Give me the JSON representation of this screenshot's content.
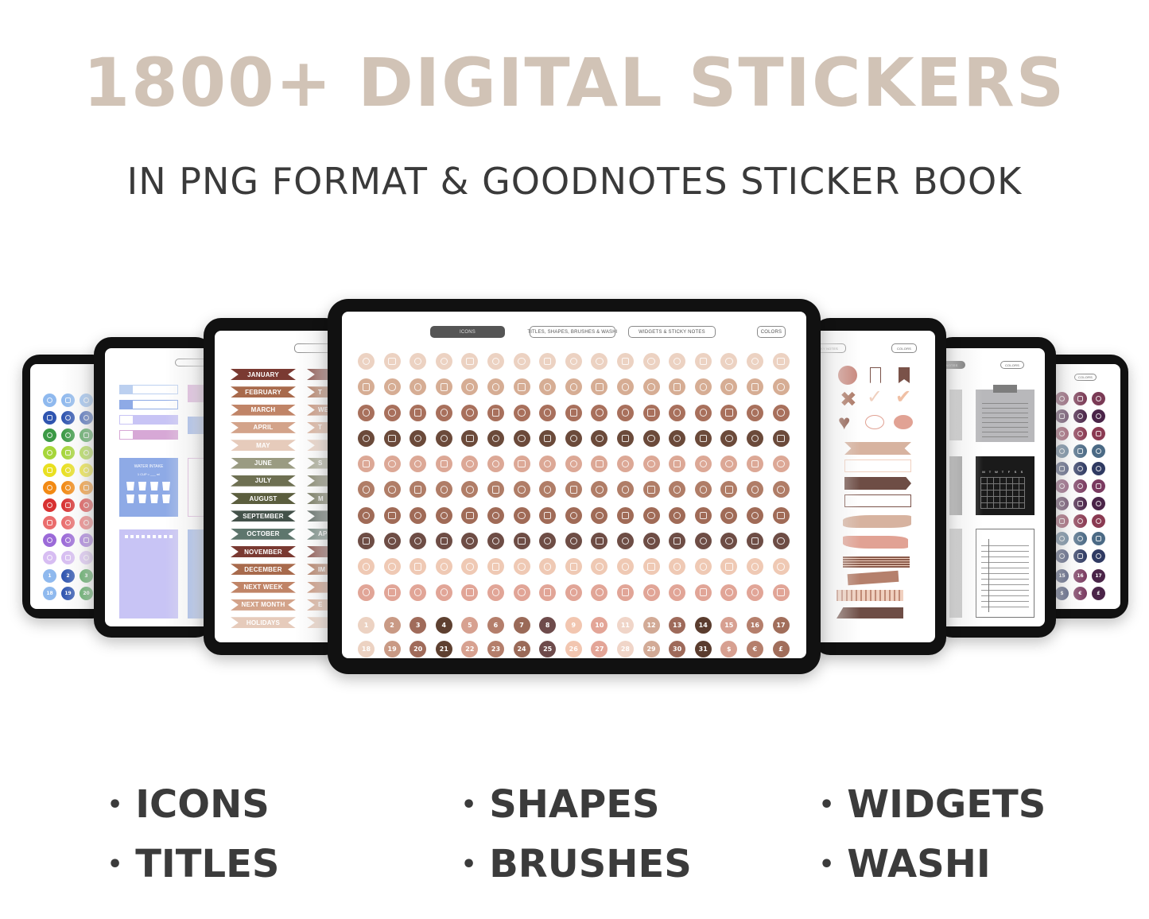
{
  "headline": "1800+ DIGITAL STICKERS",
  "subheadline": "IN PNG FORMAT & GOODNOTES STICKER BOOK",
  "center_tablet": {
    "tabs": [
      {
        "label": "ICONS",
        "active": true
      },
      {
        "label": "TITLES, SHAPES, BRUSHES & WASHI",
        "active": false
      },
      {
        "label": "WIDGETS & STICKY NOTES",
        "active": false
      },
      {
        "label": "COLORS",
        "active": false
      }
    ],
    "icon_row_colors": [
      "#ecd2c2",
      "#d6ad94",
      "#a8705c",
      "#6b4a3a",
      "#dca896",
      "#b07d67",
      "#a06b57",
      "#6e4d45",
      "#efc9b4",
      "#e1a597"
    ],
    "number_rows": [
      [
        "1",
        "2",
        "3",
        "4",
        "5",
        "6",
        "7",
        "8",
        "9",
        "10",
        "11",
        "12",
        "13",
        "14",
        "15",
        "16",
        "17"
      ],
      [
        "18",
        "19",
        "20",
        "21",
        "22",
        "23",
        "24",
        "25",
        "26",
        "27",
        "28",
        "29",
        "30",
        "31",
        "$",
        "€",
        "£"
      ]
    ],
    "number_colors": [
      "#ecd2c2",
      "#c99a85",
      "#a06b5a",
      "#5e4030",
      "#d7a190",
      "#b47e6b",
      "#9a6a58",
      "#6e4b4b",
      "#f2c6b0",
      "#e3a597",
      "#f0d5c8",
      "#d2aa96",
      "#9e6a5a",
      "#5a3c2e",
      "#d7a091",
      "#b57f6c",
      "#a16e5b"
    ]
  },
  "left_titles_tablet": {
    "tab_partial": "",
    "months": [
      {
        "label": "JANUARY",
        "color": "#7a3a32"
      },
      {
        "label": "FEBRUARY",
        "color": "#a86a4c"
      },
      {
        "label": "MARCH",
        "color": "#c08467"
      },
      {
        "label": "APRIL",
        "color": "#d3a38a"
      },
      {
        "label": "MAY",
        "color": "#e6cbbb"
      },
      {
        "label": "JUNE",
        "color": "#9a9b82"
      },
      {
        "label": "JULY",
        "color": "#6e7052"
      },
      {
        "label": "AUGUST",
        "color": "#5b5e3e"
      },
      {
        "label": "SEPTEMBER",
        "color": "#44524a"
      },
      {
        "label": "OCTOBER",
        "color": "#5e766d"
      },
      {
        "label": "NOVEMBER",
        "color": "#7a3a32"
      },
      {
        "label": "DECEMBER",
        "color": "#a86a4c"
      },
      {
        "label": "NEXT WEEK",
        "color": "#c08467"
      },
      {
        "label": "NEXT MONTH",
        "color": "#d3a38a"
      },
      {
        "label": "HOLIDAYS",
        "color": "#e6cbbb"
      }
    ],
    "second_column_fragments": [
      "",
      "T",
      "WE",
      "T",
      "",
      "S",
      "",
      "M",
      "",
      "AP",
      "",
      "IM",
      "",
      "E",
      ""
    ]
  },
  "left_widgets_tablet": {
    "widget_title": "WATER INTAKE",
    "widget_subtitle": "1 CUP = ___ ml",
    "bar_colors": [
      "#bcd0f0",
      "#8eaae6",
      "#c8c4f5",
      "#d7a8d6"
    ]
  },
  "far_left_tablet": {
    "row_colors": [
      "#8fb9ee",
      "#2f55b0",
      "#3c9a46",
      "#a6d63a",
      "#e9e021",
      "#f28a14",
      "#d83131",
      "#ea6d6d",
      "#9b6ad8",
      "#d7bdf2"
    ],
    "numbers": [
      [
        "1",
        "2",
        "3"
      ],
      [
        "18",
        "19",
        "20"
      ]
    ],
    "number_colors": [
      "#8fb9ee",
      "#2f55b0",
      "#3c9a46"
    ]
  },
  "right_shapes_tablet": {
    "tabs": [
      {
        "label": "KY NOTES"
      },
      {
        "label": "COLORS"
      }
    ],
    "palette": [
      "#d7b3a0",
      "#c08a76",
      "#7a5249",
      "#f0d0bf",
      "#e1a294"
    ]
  },
  "right_widgets_tablet": {
    "tabs": [
      {
        "label": "Y NOTES"
      },
      {
        "label": "COLORS"
      }
    ],
    "calendar_days": [
      "M",
      "T",
      "W",
      "T",
      "F",
      "S",
      "S"
    ]
  },
  "far_right_tablet": {
    "tabs": [
      {
        "label": "COLORS"
      }
    ],
    "row_colors": [
      "#7a3a55",
      "#4a2448",
      "#8a3a52",
      "#4b6a85",
      "#2f3a62",
      "#7a3a60",
      "#4a2448",
      "#8a3a52",
      "#4b6a85",
      "#2f3a62"
    ],
    "numbers": [
      [
        "15",
        "16",
        "17"
      ],
      [
        "$",
        "€",
        "£"
      ]
    ],
    "number_colors": [
      "#2f3a62",
      "#7a3a60",
      "#4a2448"
    ]
  },
  "features": {
    "col1": [
      "ICONS",
      "TITLES"
    ],
    "col2": [
      "SHAPES",
      "BRUSHES"
    ],
    "col3": [
      "WIDGETS",
      "WASHI"
    ]
  }
}
